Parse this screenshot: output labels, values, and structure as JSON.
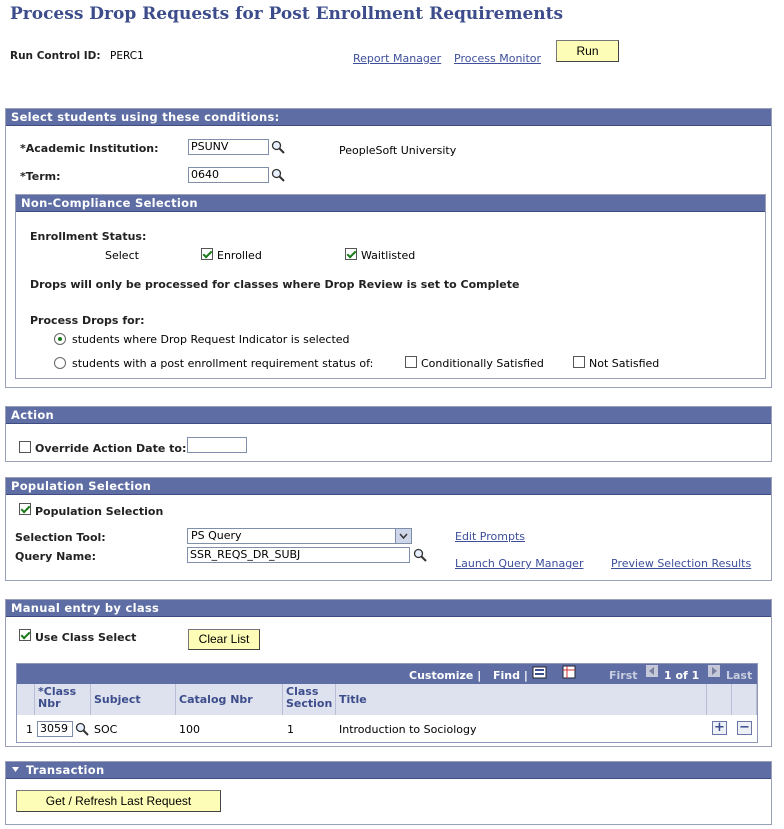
{
  "page_title": "Process Drop Requests for Post Enrollment Requirements",
  "run_control": {
    "label": "Run Control ID:",
    "value": "PERC1"
  },
  "header_links": {
    "report_manager": "Report Manager",
    "process_monitor": "Process Monitor",
    "run": "Run"
  },
  "select_students": {
    "title": "Select students using these conditions:",
    "institution_label": "*Academic Institution:",
    "institution_value": "PSUNV",
    "institution_desc": "PeopleSoft University",
    "term_label": "*Term:",
    "term_value": "0640"
  },
  "non_compliance": {
    "title": "Non-Compliance Selection",
    "enrollment_status_label": "Enrollment Status:",
    "select_label": "Select",
    "enrolled_label": "Enrolled",
    "enrolled_checked": true,
    "waitlisted_label": "Waitlisted",
    "waitlisted_checked": true,
    "drop_note": "Drops will only be processed for classes where Drop Review is set to Complete",
    "process_drops_label": "Process Drops for:",
    "option_indicator": "students where Drop Request Indicator is selected",
    "option_status": "students with a post enrollment requirement status of:",
    "selected_option": "indicator",
    "cond_satisfied_label": "Conditionally Satisfied",
    "not_satisfied_label": "Not Satisfied"
  },
  "action": {
    "title": "Action",
    "override_label": "Override Action Date to:",
    "override_value": ""
  },
  "population": {
    "title": "Population Selection",
    "checkbox_label": "Population Selection",
    "tool_label": "Selection Tool:",
    "tool_value": "PS Query",
    "query_label": "Query Name:",
    "query_value": "SSR_REQS_DR_SUBJ",
    "edit_prompts": "Edit Prompts",
    "launch_query": "Launch Query Manager",
    "preview": "Preview Selection Results"
  },
  "manual": {
    "title": "Manual entry by class",
    "use_class_label": "Use Class Select",
    "clear_list": "Clear List",
    "grid_toolbar": {
      "customize": "Customize",
      "find": "Find",
      "first": "First",
      "range": "1 of 1",
      "last": "Last"
    },
    "columns": [
      "*Class Nbr",
      "Subject",
      "Catalog Nbr",
      "Class Section",
      "Title"
    ],
    "rows": [
      {
        "num": "1",
        "class_nbr": "3059",
        "subject": "SOC",
        "catalog": "100",
        "section": "1",
        "title": "Introduction to Sociology"
      }
    ]
  },
  "transaction": {
    "title": "Transaction",
    "button": "Get / Refresh Last Request"
  }
}
